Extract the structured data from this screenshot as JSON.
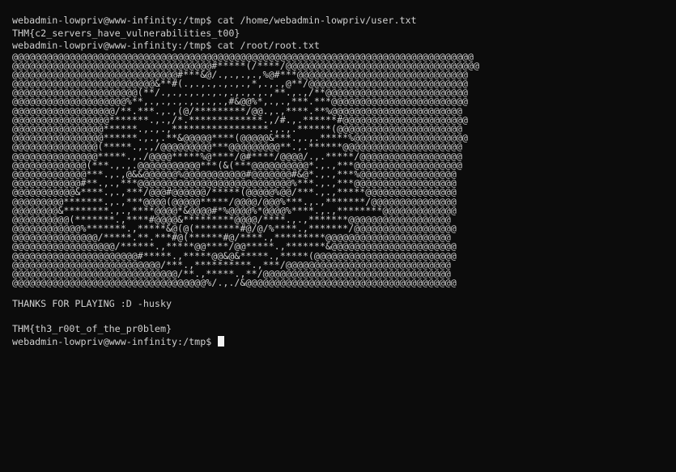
{
  "terminal": {
    "lines_before_art": [
      "webadmin-lowpriv@www-infinity:/tmp$ cat /home/webadmin-lowpriv/user.txt",
      "THM{c2_servers_have_vulnerabilities_t00}",
      "webadmin-lowpriv@www-infinity:/tmp$ cat /root/root.txt"
    ],
    "art": [
      "@@@@@@@@@@@@@@@@@@@@@@@@@@@@@@@@@@@@@@@@@@@@@@@@@@@@@@@@@@@@@@@@@@@@@@@@@@@@@@@@@",
      "@@@@@@@@@@@@@@@@@@@@@@@@@@@@@@@@@@@#*****(/****/@@@@@@@@@@@@@@@@@@@@@@@@@@@@@@@@@@",
      "@@@@@@@@@@@@@@@@@@@@@@@@@@@@@#***&@/.,.,.,.,%@#***@@@@@@@@@@@@@@@@@@@@@@@@@@@@@@",
      "@@@@@@@@@@@@@@@@@@@@@@@@@&**#(.,.,.,.,.,.,*,.,.,@**/@@@@@@@@@@@@@@@@@@@@@@@@@@@@",
      "@@@@@@@@@@@@@@@@@@@@@@(**/.,.,.,.,.,.,.,.,.,.,**.,.,/**@@@@@@@@@@@@@@@@@@@@@@@@@",
      "@@@@@@@@@@@@@@@@@@@@%**,.,.,.,.,.,.,.,#&@@%*,.,.,***.***@@@@@@@@@@@@@@@@@@@@@@@@",
      "@@@@@@@@@@@@@@@@@@/**.***.,.,(@/*********/@@.,.,****.**%@@@@@@@@@@@@@@@@@@@@@@@",
      "@@@@@@@@@@@@@@@@@*******.,.,/*.*************.,/#.,.******#@@@@@@@@@@@@@@@@@@@@@@",
      "@@@@@@@@@@@@@@@@******.,.,.,*****************.,.,.******(@@@@@@@@@@@@@@@@@@@@@@",
      "@@@@@@@@@@@@@@@@******.,.,.**&@@@@@****(@@@@@&***.,.,.*****%@@@@@@@@@@@@@@@@@@@@",
      "@@@@@@@@@@@@@@@(*****.,.,/@@@@@@@@@***@@@@@@@@@**.,.******@@@@@@@@@@@@@@@@@@@@@",
      "@@@@@@@@@@@@@@@*****.,./@@@@*****%@****/@#****/@@@@/.,.*****/@@@@@@@@@@@@@@@@@@",
      "@@@@@@@@@@@@@(***.,.,.@@@@@@@@@@@***(&(***@@@@@@@@@@*.,.,***@@@@@@@@@@@@@@@@@@@",
      "@@@@@@@@@@@@@***.,.,@&&@@@@@@%@@@@@@@@@@@#@@@@@@@#&@*.,.,***%@@@@@@@@@@@@@@@@@",
      "@@@@@@@@@@@@#**.,.,***@@@@@@@@@@@@@@@@@@@@@@@@@@@%***.,.,***@@@@@@@@@@@@@@@@@@",
      "@@@@@@@@@@@&****.,.,***/@@@#@@@@@@/*****(@@@@@%@@/***.,.,*****@@@@@@@@@@@@@@@@",
      "@@@@@@@@@*******.,.,***@@@@(@@@@@*****/@@@@/@@@%***.,.,*******/@@@@@@@@@@@@@@@",
      "@@@@@@@@&********.,.,****@@@@*&@@@@#*%@@@@%*@@@@%****.,.,********@@@@@@@@@@@@@",
      "@@@@@@@@@@(*******.,****#@@@@&*********@@@@/****.,.,*******@@@@@@@@@@@@@@@@@@",
      "@@@@@@@@@@@@%*******.,*****&@(@(********#@/@/%****.,*******/@@@@@@@@@@@@@@@@@@",
      "@@@@@@@@@@@@@@@/*****.**.***#@(******#@/****.,*********@@@@@@@@@@@@@@@@@@@@@@",
      "@@@@@@@@@@@@@@@@@@/******.,*****@@****/@@*****.,*******&@@@@@@@@@@@@@@@@@@@@@@",
      "@@@@@@@@@@@@@@@@@@@@@@#*****.,*****@@&@&*****.,*****(@@@@@@@@@@@@@@@@@@@@@@@@@",
      "@@@@@@@@@@@@@@@@@@@@@@@@@@/***.,**********.,***/@@@@@@@@@@@@@@@@@@@@@@@@@@@@@",
      "@@@@@@@@@@@@@@@@@@@@@@@@@@@@@/**.,*****.,**/@@@@@@@@@@@@@@@@@@@@@@@@@@@@@@@@@",
      "@@@@@@@@@@@@@@@@@@@@@@@@@@@@@@@@@@%/.,./&@@@@@@@@@@@@@@@@@@@@@@@@@@@@@@@@@@@@@"
    ],
    "thanks_line": "THANKS FOR PLAYING :D -husky",
    "root_flag": "THM{th3_r00t_of_the_pr0blem}",
    "final_prompt": "webadmin-lowpriv@www-infinity:/tmp$ "
  }
}
